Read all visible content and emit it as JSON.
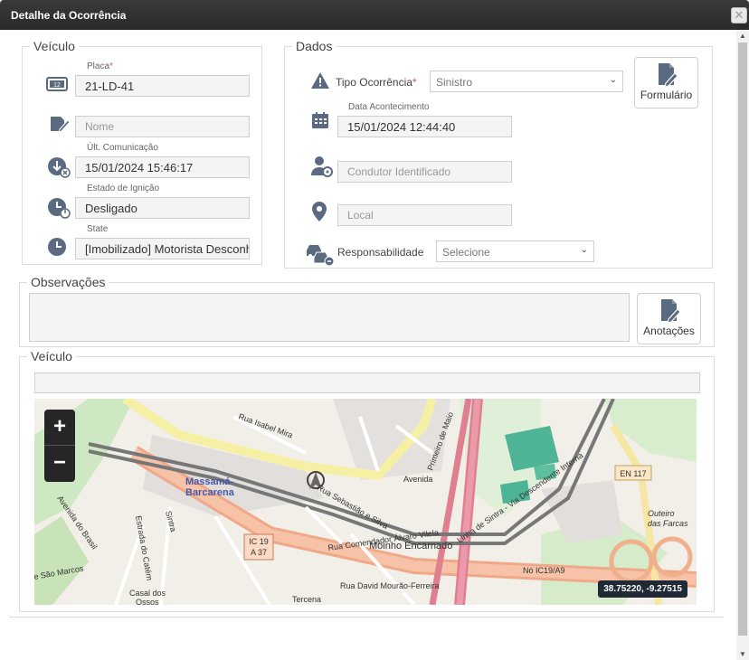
{
  "window": {
    "title": "Detalhe da Ocorrência",
    "close_glyph": "✕"
  },
  "vehicle": {
    "legend": "Veículo",
    "plate_label": "Placa",
    "plate_required": "*",
    "plate_value": "21-LD-41",
    "name_placeholder": "Nome",
    "last_comm_label": "Últ. Comunicação",
    "last_comm_value": "15/01/2024 15:46:17",
    "ignition_label": "Estado de Ignição",
    "ignition_value": "Desligado",
    "state_label": "State",
    "state_value": "[Imobilizado] Motorista Desconhecido"
  },
  "dados": {
    "legend": "Dados",
    "tipo_label": "Tipo Ocorrência",
    "tipo_required": "*",
    "tipo_value": "Sinistro",
    "date_label": "Data Acontecimento",
    "date_value": "15/01/2024 12:44:40",
    "driver_placeholder": "Condutor Identificado",
    "local_placeholder": "Local",
    "resp_label": "Responsabilidade",
    "resp_value": "Selecione",
    "form_button": "Formulário"
  },
  "observacoes": {
    "legend": "Observações",
    "notes_button": "Anotações"
  },
  "vehicle_map": {
    "legend": "Veículo",
    "zoom_in": "+",
    "zoom_out": "−",
    "coordinates": "38.75220, -9.27515",
    "map_labels": {
      "town": "Massamá-Barcarena",
      "road_ic19": "IC 19",
      "road_a37": "A 37",
      "road_en117": "EN 117",
      "street_1": "Rua Sebastião e Silva",
      "street_2": "Rua Comendador Álvaro Vilela",
      "street_3": "Rua David Mourão-Ferreira",
      "street_4": "Rua Isabel Mira",
      "place_1": "Moinho Encarnado",
      "place_2": "Casal dos Ossos",
      "place_3": "Outeiro das Farcas",
      "road_no": "Nó IC19/A9",
      "street_5": "Avenida do Brasil",
      "street_6": "Linha de Sintra - Via Descendente Interna",
      "place_4": "Tercena",
      "street_7": "Estrada do Catém",
      "place_5": "e São Marcos",
      "street_8": "Sintra",
      "street_9": "Avenida",
      "street_10": "Primeiro de Maio"
    }
  },
  "colors": {
    "titlebar": "#2f2f2f",
    "icon": "#5a6a80",
    "motorway": "#e8929f",
    "trunk": "#f4b49a",
    "rail": "#8a8a8a"
  }
}
